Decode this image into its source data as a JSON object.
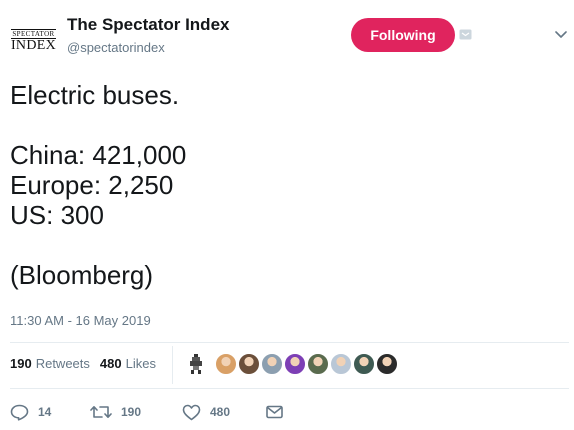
{
  "account": {
    "logo_line1": "SPECTATOR",
    "logo_line2": "INDEX",
    "display_name": "The Spectator Index",
    "handle": "@spectatorindex"
  },
  "header": {
    "follow_label": "Following",
    "follow_color": "#e0245e"
  },
  "tweet": {
    "text": "Electric buses.\n\nChina: 421,000\nEurope: 2,250\nUS: 300\n\n(Bloomberg)",
    "timestamp": "11:30 AM - 16 May 2019"
  },
  "stats": {
    "retweets_count": "190",
    "retweets_label": "Retweets",
    "likes_count": "480",
    "likes_label": "Likes"
  },
  "likers": [
    {
      "name": "liker-1",
      "color": "#d9a066"
    },
    {
      "name": "liker-2",
      "color": "#6b4f3a"
    },
    {
      "name": "liker-3",
      "color": "#8c9fb0"
    },
    {
      "name": "liker-4",
      "color": "#7d3fb5"
    },
    {
      "name": "liker-5",
      "color": "#5a6b4e"
    },
    {
      "name": "liker-6",
      "color": "#b9c7d6"
    },
    {
      "name": "liker-7",
      "color": "#3e5a52"
    },
    {
      "name": "liker-8",
      "color": "#2b2b2b"
    }
  ],
  "actions": {
    "reply_count": "14",
    "retweet_count": "190",
    "like_count": "480"
  },
  "icons": {
    "reply": "reply-icon",
    "retweet": "retweet-icon",
    "like": "heart-icon",
    "dm": "envelope-icon",
    "notifications": "notification-icon",
    "more": "chevron-down-icon"
  },
  "colors": {
    "secondary_text": "#657786",
    "primary_text": "#14171a",
    "divider": "#e6ecf0"
  }
}
